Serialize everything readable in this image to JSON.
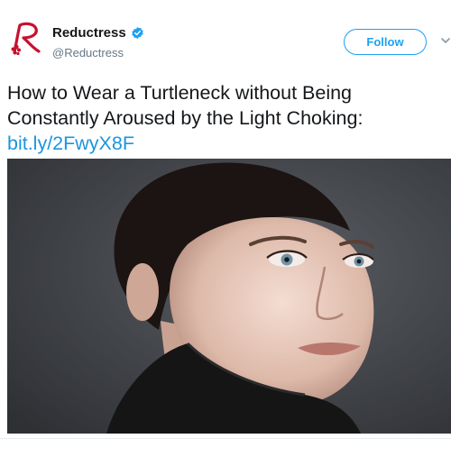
{
  "account": {
    "display_name": "Reductress",
    "handle": "@Reductress",
    "verified": true,
    "avatar_icon": "reductress-logo-icon",
    "logo_letter": "R"
  },
  "actions": {
    "follow_label": "Follow",
    "menu_icon": "chevron-down-icon"
  },
  "tweet": {
    "line1": "How to Wear a Turtleneck without Being",
    "line2": "Constantly Aroused by the Light Choking:",
    "link": "bit.ly/2FwyX8F"
  },
  "media": {
    "type": "photo",
    "background_color": "#3d3f44"
  },
  "colors": {
    "brand": "#c8102e",
    "accent": "#1da1f2",
    "link": "#1b95e0",
    "text": "#14171a",
    "muted": "#657786"
  }
}
